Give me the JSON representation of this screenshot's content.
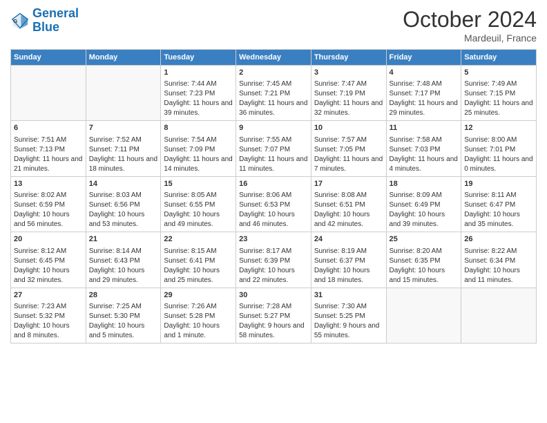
{
  "header": {
    "logo_line1": "General",
    "logo_line2": "Blue",
    "month": "October 2024",
    "location": "Mardeuil, France"
  },
  "weekdays": [
    "Sunday",
    "Monday",
    "Tuesday",
    "Wednesday",
    "Thursday",
    "Friday",
    "Saturday"
  ],
  "weeks": [
    [
      {
        "day": "",
        "info": ""
      },
      {
        "day": "",
        "info": ""
      },
      {
        "day": "1",
        "info": "Sunrise: 7:44 AM\nSunset: 7:23 PM\nDaylight: 11 hours and 39 minutes."
      },
      {
        "day": "2",
        "info": "Sunrise: 7:45 AM\nSunset: 7:21 PM\nDaylight: 11 hours and 36 minutes."
      },
      {
        "day": "3",
        "info": "Sunrise: 7:47 AM\nSunset: 7:19 PM\nDaylight: 11 hours and 32 minutes."
      },
      {
        "day": "4",
        "info": "Sunrise: 7:48 AM\nSunset: 7:17 PM\nDaylight: 11 hours and 29 minutes."
      },
      {
        "day": "5",
        "info": "Sunrise: 7:49 AM\nSunset: 7:15 PM\nDaylight: 11 hours and 25 minutes."
      }
    ],
    [
      {
        "day": "6",
        "info": "Sunrise: 7:51 AM\nSunset: 7:13 PM\nDaylight: 11 hours and 21 minutes."
      },
      {
        "day": "7",
        "info": "Sunrise: 7:52 AM\nSunset: 7:11 PM\nDaylight: 11 hours and 18 minutes."
      },
      {
        "day": "8",
        "info": "Sunrise: 7:54 AM\nSunset: 7:09 PM\nDaylight: 11 hours and 14 minutes."
      },
      {
        "day": "9",
        "info": "Sunrise: 7:55 AM\nSunset: 7:07 PM\nDaylight: 11 hours and 11 minutes."
      },
      {
        "day": "10",
        "info": "Sunrise: 7:57 AM\nSunset: 7:05 PM\nDaylight: 11 hours and 7 minutes."
      },
      {
        "day": "11",
        "info": "Sunrise: 7:58 AM\nSunset: 7:03 PM\nDaylight: 11 hours and 4 minutes."
      },
      {
        "day": "12",
        "info": "Sunrise: 8:00 AM\nSunset: 7:01 PM\nDaylight: 11 hours and 0 minutes."
      }
    ],
    [
      {
        "day": "13",
        "info": "Sunrise: 8:02 AM\nSunset: 6:59 PM\nDaylight: 10 hours and 56 minutes."
      },
      {
        "day": "14",
        "info": "Sunrise: 8:03 AM\nSunset: 6:56 PM\nDaylight: 10 hours and 53 minutes."
      },
      {
        "day": "15",
        "info": "Sunrise: 8:05 AM\nSunset: 6:55 PM\nDaylight: 10 hours and 49 minutes."
      },
      {
        "day": "16",
        "info": "Sunrise: 8:06 AM\nSunset: 6:53 PM\nDaylight: 10 hours and 46 minutes."
      },
      {
        "day": "17",
        "info": "Sunrise: 8:08 AM\nSunset: 6:51 PM\nDaylight: 10 hours and 42 minutes."
      },
      {
        "day": "18",
        "info": "Sunrise: 8:09 AM\nSunset: 6:49 PM\nDaylight: 10 hours and 39 minutes."
      },
      {
        "day": "19",
        "info": "Sunrise: 8:11 AM\nSunset: 6:47 PM\nDaylight: 10 hours and 35 minutes."
      }
    ],
    [
      {
        "day": "20",
        "info": "Sunrise: 8:12 AM\nSunset: 6:45 PM\nDaylight: 10 hours and 32 minutes."
      },
      {
        "day": "21",
        "info": "Sunrise: 8:14 AM\nSunset: 6:43 PM\nDaylight: 10 hours and 29 minutes."
      },
      {
        "day": "22",
        "info": "Sunrise: 8:15 AM\nSunset: 6:41 PM\nDaylight: 10 hours and 25 minutes."
      },
      {
        "day": "23",
        "info": "Sunrise: 8:17 AM\nSunset: 6:39 PM\nDaylight: 10 hours and 22 minutes."
      },
      {
        "day": "24",
        "info": "Sunrise: 8:19 AM\nSunset: 6:37 PM\nDaylight: 10 hours and 18 minutes."
      },
      {
        "day": "25",
        "info": "Sunrise: 8:20 AM\nSunset: 6:35 PM\nDaylight: 10 hours and 15 minutes."
      },
      {
        "day": "26",
        "info": "Sunrise: 8:22 AM\nSunset: 6:34 PM\nDaylight: 10 hours and 11 minutes."
      }
    ],
    [
      {
        "day": "27",
        "info": "Sunrise: 7:23 AM\nSunset: 5:32 PM\nDaylight: 10 hours and 8 minutes."
      },
      {
        "day": "28",
        "info": "Sunrise: 7:25 AM\nSunset: 5:30 PM\nDaylight: 10 hours and 5 minutes."
      },
      {
        "day": "29",
        "info": "Sunrise: 7:26 AM\nSunset: 5:28 PM\nDaylight: 10 hours and 1 minute."
      },
      {
        "day": "30",
        "info": "Sunrise: 7:28 AM\nSunset: 5:27 PM\nDaylight: 9 hours and 58 minutes."
      },
      {
        "day": "31",
        "info": "Sunrise: 7:30 AM\nSunset: 5:25 PM\nDaylight: 9 hours and 55 minutes."
      },
      {
        "day": "",
        "info": ""
      },
      {
        "day": "",
        "info": ""
      }
    ]
  ]
}
